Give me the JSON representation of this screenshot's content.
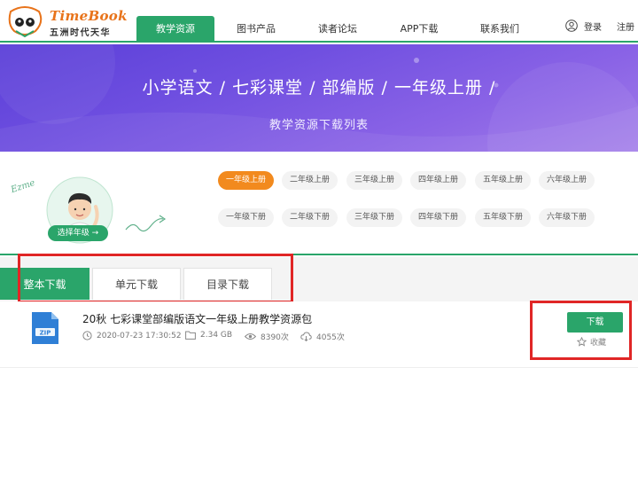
{
  "header": {
    "logo": {
      "name_en": "TimeBook",
      "name_cn": "五洲时代天华"
    },
    "nav": [
      {
        "label": "教学资源",
        "active": true
      },
      {
        "label": "图书产品",
        "active": false
      },
      {
        "label": "读者论坛",
        "active": false
      },
      {
        "label": "APP下载",
        "active": false
      },
      {
        "label": "联系我们",
        "active": false
      }
    ],
    "login": "登录",
    "register": "注册",
    "user_icon": "user-icon"
  },
  "banner": {
    "title": "小学语文 / 七彩课堂 / 部编版 / 一年级上册 /",
    "subtitle": "教学资源下载列表"
  },
  "grade_panel": {
    "select_grade_label": "选择年级 →",
    "doodle_text": "Ezme",
    "grades_row1": [
      {
        "label": "一年级上册",
        "active": true
      },
      {
        "label": "二年级上册",
        "active": false
      },
      {
        "label": "三年级上册",
        "active": false
      },
      {
        "label": "四年级上册",
        "active": false
      },
      {
        "label": "五年级上册",
        "active": false
      },
      {
        "label": "六年级上册",
        "active": false
      }
    ],
    "grades_row2": [
      {
        "label": "一年级下册",
        "active": false
      },
      {
        "label": "二年级下册",
        "active": false
      },
      {
        "label": "三年级下册",
        "active": false
      },
      {
        "label": "四年级下册",
        "active": false
      },
      {
        "label": "五年级下册",
        "active": false
      },
      {
        "label": "六年级下册",
        "active": false
      }
    ]
  },
  "tabs": [
    {
      "label": "整本下载",
      "active": true
    },
    {
      "label": "单元下载",
      "active": false
    },
    {
      "label": "目录下载",
      "active": false
    }
  ],
  "resource": {
    "title": "20秋 七彩课堂部编版语文一年级上册教学资源包",
    "date": "2020-07-23 17:30:52",
    "size": "2.34 GB",
    "views": "8390次",
    "downloads": "4055次",
    "file_type": "ZIP",
    "download_label": "下载",
    "favorite_label": "收藏"
  },
  "colors": {
    "brand_green": "#2aa56a",
    "accent_orange": "#f28a1e",
    "highlight_red": "#e02626",
    "banner_purple": "#6f4fe0"
  }
}
